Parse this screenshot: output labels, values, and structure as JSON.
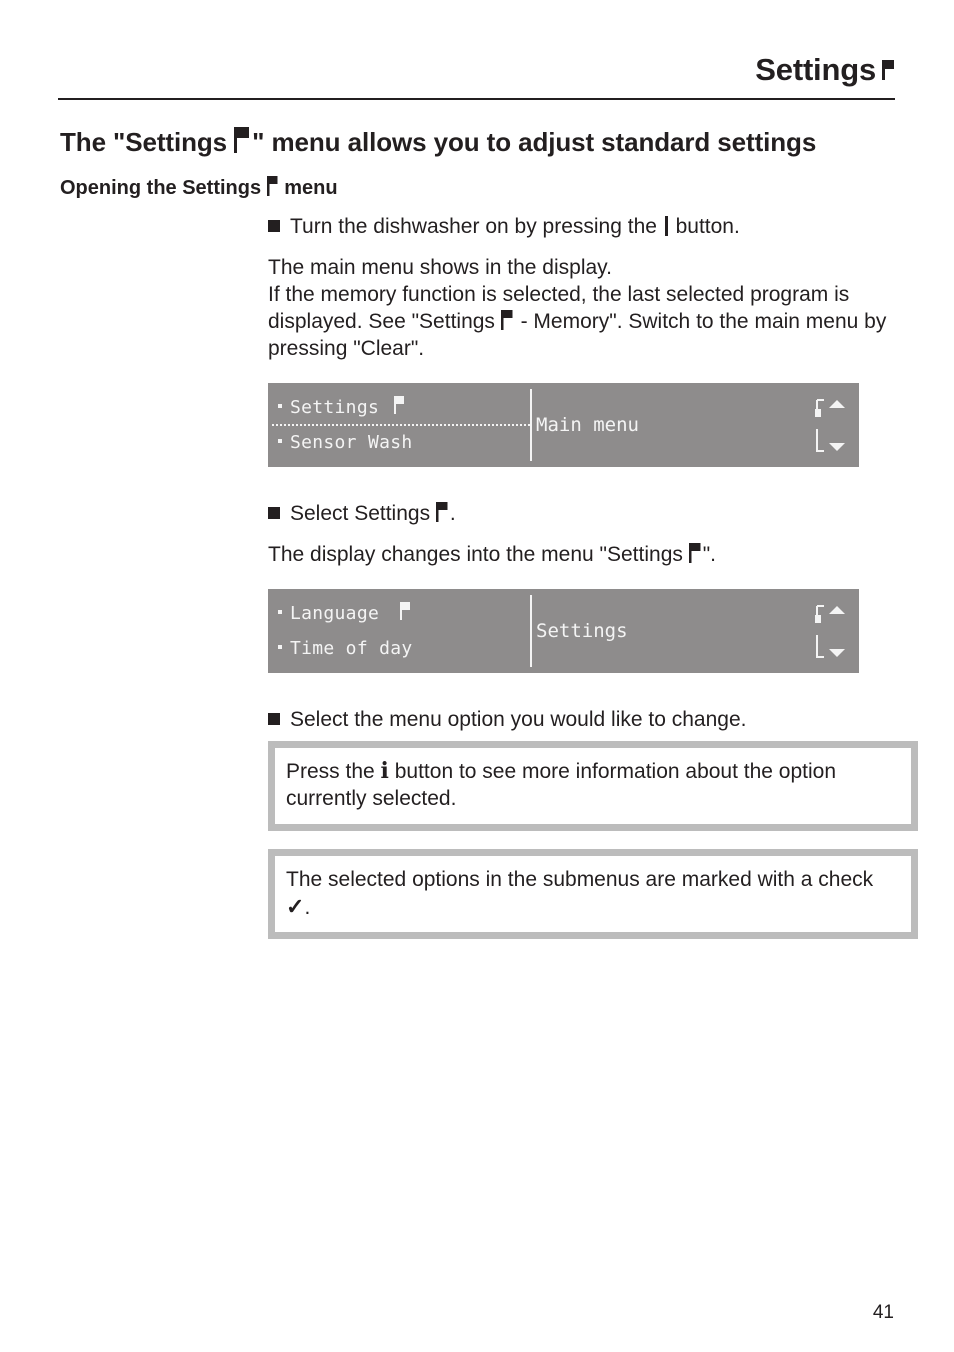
{
  "header": {
    "title": "Settings",
    "icon": "flag-icon"
  },
  "section": {
    "title_before_icon": "The \"Settings ",
    "title_after_icon": "\" menu allows you to adjust standard settings",
    "subtitle_before_icon": "Opening the Settings ",
    "subtitle_after_icon": " menu"
  },
  "steps": {
    "step1_before": "Turn the dishwasher on by pressing the ",
    "step1_after": " button.",
    "para1_line1": "The main menu shows in the display.",
    "para1_line2_before": "If the memory function is selected, the last selected program is displayed. See \"Settings ",
    "para1_line2_after": " - Memory\". Switch to the main menu by pressing \"Clear\".",
    "step2_before": "Select Settings ",
    "step2_after": ".",
    "para2_before": "The display changes into the menu \"Settings  ",
    "para2_after": "\".",
    "step3": "Select the menu option you would like to change."
  },
  "display1": {
    "items": [
      "Settings",
      "Sensor Wash"
    ],
    "first_item_has_flag": true,
    "label": "Main menu"
  },
  "display2": {
    "items": [
      "Language",
      "Time of day"
    ],
    "first_item_has_flag": true,
    "label": "Settings"
  },
  "notes": {
    "note1_before": "Press the ",
    "note1_icon": "i",
    "note1_after": " button to see more information about the option currently selected.",
    "note2_before": "The selected options in the submenus are marked with a check ",
    "note2_icon": "✓",
    "note2_after": "."
  },
  "footer": {
    "page_number": "41"
  },
  "colors": {
    "text": "#231f20",
    "display_bg": "#8e8c8c",
    "display_text": "#f4f4f4",
    "note_border": "#bcbcbc"
  }
}
